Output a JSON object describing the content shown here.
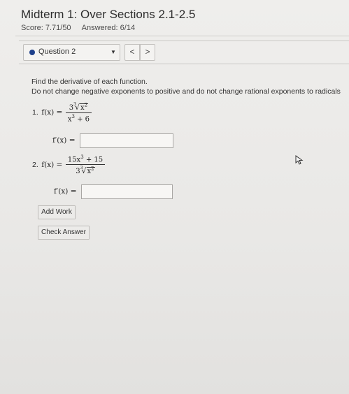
{
  "header": {
    "title": "Midterm 1: Over Sections 2.1-2.5",
    "score": "Score: 7.71/50",
    "answered": "Answered: 6/14"
  },
  "question_nav": {
    "selected": "Question 2",
    "prev": "<",
    "next": ">"
  },
  "instructions": {
    "line1": "Find the derivative of each function.",
    "line2": "Do not change negative exponents to positive and do not change rational exponents to radicals"
  },
  "problems": [
    {
      "number": "1.",
      "lhs": "f(x) =",
      "numerator_coef": "3",
      "numerator_radical_index": "3",
      "numerator_radicand": "x",
      "numerator_radicand_exp": "2",
      "denominator_base": "x",
      "denominator_exp": "3",
      "denominator_rest": " + 6",
      "answer_label": "f′(x) =",
      "answer_value": ""
    },
    {
      "number": "2.",
      "lhs": "f(x) =",
      "numerator_coef": "15x",
      "numerator_exp": "3",
      "numerator_rest": " + 15",
      "denominator_coef": "3",
      "denominator_radical_index": "3",
      "denominator_radicand": "x",
      "denominator_radicand_exp": "2",
      "answer_label": "f′(x) =",
      "answer_value": ""
    }
  ],
  "buttons": {
    "add_work": "Add Work",
    "check_answer": "Check Answer"
  },
  "colors": {
    "question_dot": "#1d3f8a",
    "background": "#e9e8e6"
  },
  "icons": {
    "cursor": "mouse-pointer-icon",
    "caret": "chevron-down-icon"
  }
}
